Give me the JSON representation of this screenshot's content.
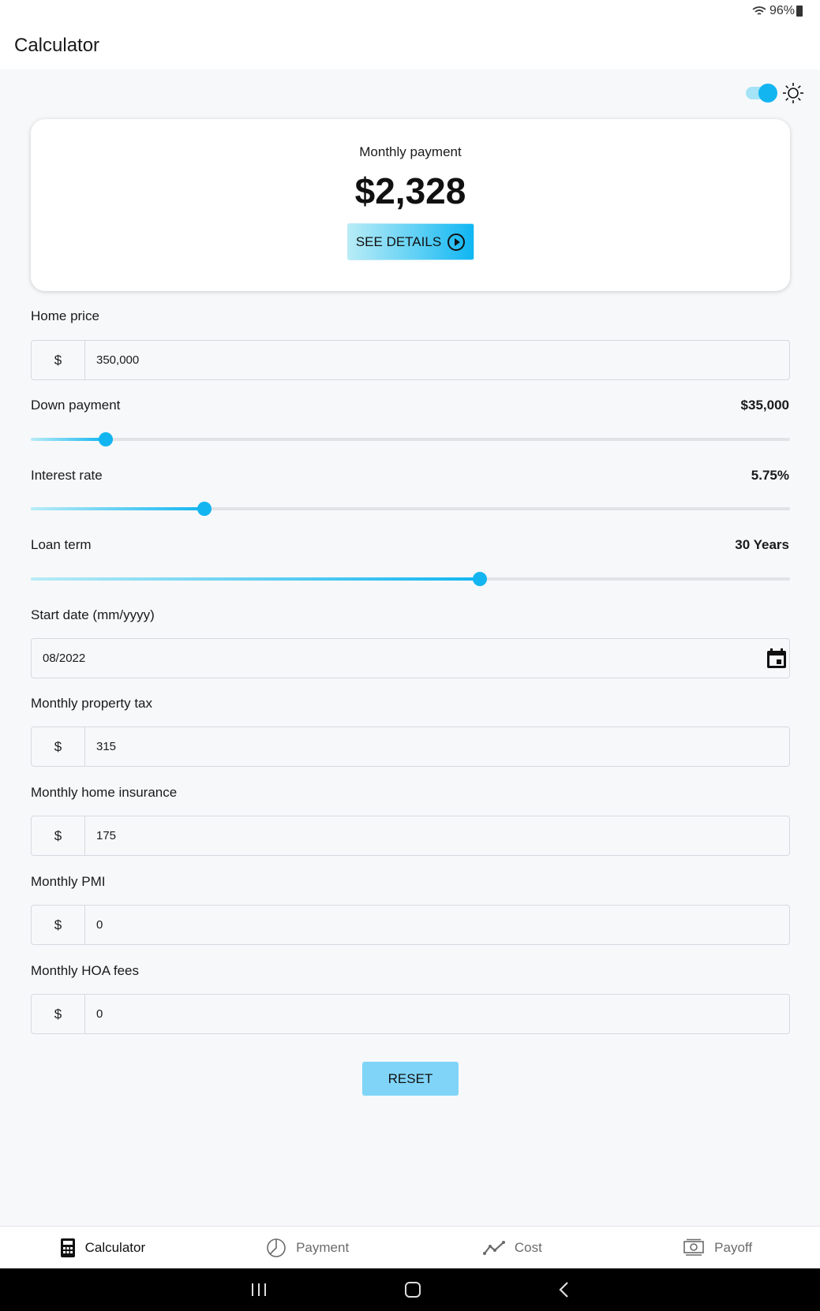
{
  "status_bar": {
    "battery": "96%"
  },
  "app_bar": {
    "title": "Calculator"
  },
  "summary": {
    "label": "Monthly payment",
    "amount": "$2,328",
    "details_label": "SEE DETAILS"
  },
  "home_price": {
    "label": "Home price",
    "prefix": "$",
    "value": "350,000"
  },
  "down_payment": {
    "label": "Down payment",
    "value": "$35,000",
    "slider_fraction": 0.099
  },
  "interest_rate": {
    "label": "Interest rate",
    "value": "5.75%",
    "slider_fraction": 0.229
  },
  "loan_term": {
    "label": "Loan term",
    "value": "30 Years",
    "slider_fraction": 0.591
  },
  "start_date": {
    "label": "Start date (mm/yyyy)",
    "value": "08/2022"
  },
  "property_tax": {
    "label": "Monthly property tax",
    "prefix": "$",
    "value": "315"
  },
  "home_insurance": {
    "label": "Monthly home insurance",
    "prefix": "$",
    "value": "175"
  },
  "pmi": {
    "label": "Monthly PMI",
    "prefix": "$",
    "value": "0"
  },
  "hoa": {
    "label": "Monthly HOA fees",
    "prefix": "$",
    "value": "0"
  },
  "reset_label": "RESET",
  "nav": {
    "items": [
      {
        "label": "Calculator",
        "icon": "calculator-icon",
        "active": true
      },
      {
        "label": "Payment",
        "icon": "pie-chart-icon",
        "active": false
      },
      {
        "label": "Cost",
        "icon": "line-chart-icon",
        "active": false
      },
      {
        "label": "Payoff",
        "icon": "money-icon",
        "active": false
      }
    ]
  },
  "colors": {
    "accent": "#12b5f0",
    "reset": "#80d4f8",
    "background": "#f7f8fa"
  }
}
